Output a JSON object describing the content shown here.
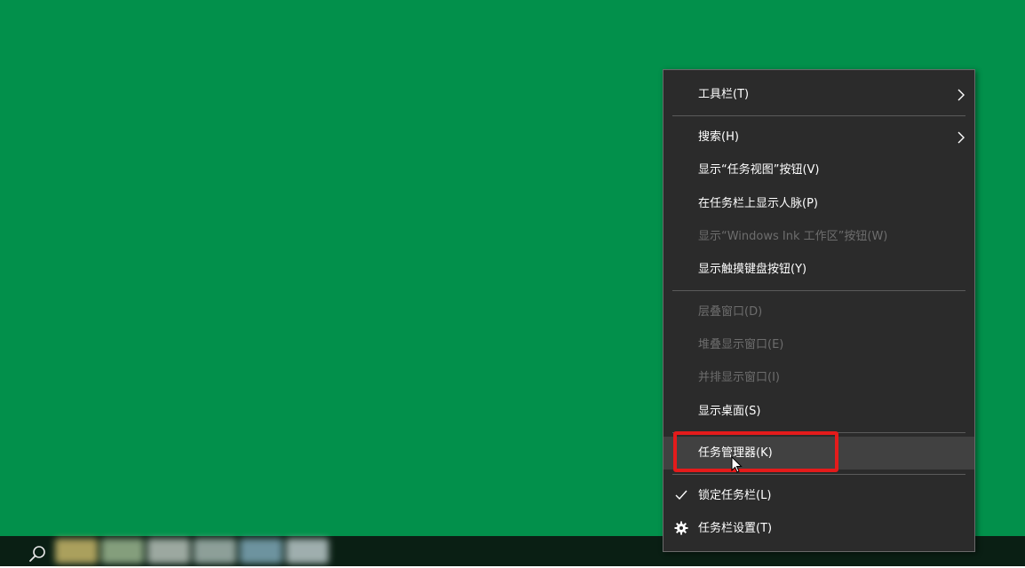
{
  "desktop": {
    "background_color": "#02904b"
  },
  "taskbar": {
    "background_color": "#0a1f14",
    "search_icon": "search-icon",
    "app_colors": [
      "#c7b76a",
      "#9ab58f",
      "#b6c1b9",
      "#a4b6b0",
      "#7fa8b8",
      "#b9c8c9"
    ]
  },
  "context_menu": {
    "background_color": "#2b2b2b",
    "items": [
      {
        "label": "工具栏(T)",
        "enabled": true,
        "submenu": true
      },
      {
        "label": "搜索(H)",
        "enabled": true,
        "submenu": true
      },
      {
        "label": "显示“任务视图”按钮(V)",
        "enabled": true
      },
      {
        "label": "在任务栏上显示人脉(P)",
        "enabled": true
      },
      {
        "label": "显示“Windows Ink 工作区”按钮(W)",
        "enabled": false
      },
      {
        "label": "显示触摸键盘按钮(Y)",
        "enabled": true
      },
      {
        "label": "层叠窗口(D)",
        "enabled": false
      },
      {
        "label": "堆叠显示窗口(E)",
        "enabled": false
      },
      {
        "label": "并排显示窗口(I)",
        "enabled": false
      },
      {
        "label": "显示桌面(S)",
        "enabled": true
      },
      {
        "label": "任务管理器(K)",
        "enabled": true,
        "hovered": true
      },
      {
        "label": "锁定任务栏(L)",
        "enabled": true,
        "checked": true,
        "icon": "checkmark-icon"
      },
      {
        "label": "任务栏设置(T)",
        "enabled": true,
        "icon": "gear-icon"
      }
    ]
  },
  "annotation": {
    "highlight_color": "#e41b1b",
    "highlighted_item": "任务管理器(K)"
  }
}
